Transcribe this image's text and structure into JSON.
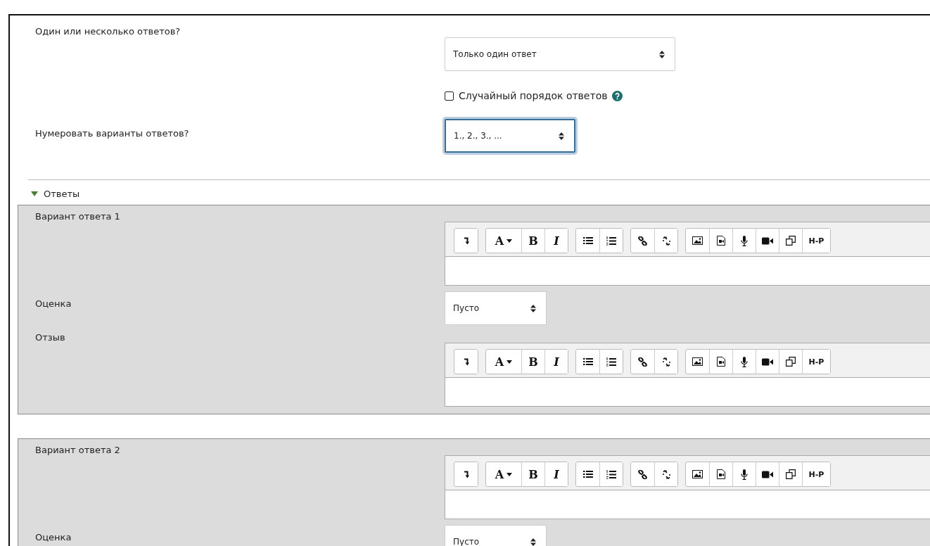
{
  "general_rows": [
    {
      "kind": "select",
      "label": "Один или несколько ответов?",
      "value": "Только один ответ",
      "focused": false
    },
    {
      "kind": "checkbox",
      "label": "Случайный порядок ответов",
      "checked": false,
      "help": true
    },
    {
      "kind": "select",
      "label": "Нумеровать варианты ответов?",
      "value": "1., 2., 3., ...",
      "focused": true
    }
  ],
  "section": {
    "title": "Ответы",
    "expanded": true
  },
  "answers": [
    {
      "fields": [
        {
          "kind": "editor",
          "label": "Вариант ответа 1",
          "toolbar": {
            "font_label": "A",
            "bold_label": "B",
            "italic_label": "I",
            "h5p_label": "H-P"
          }
        },
        {
          "kind": "select",
          "label": "Оценка",
          "value": "Пусто",
          "focused": false
        },
        {
          "kind": "editor",
          "label": "Отзыв",
          "toolbar": {
            "font_label": "A",
            "bold_label": "B",
            "italic_label": "I",
            "h5p_label": "H-P"
          }
        }
      ]
    },
    {
      "fields": [
        {
          "kind": "editor",
          "label": "Вариант ответа 2",
          "toolbar": {
            "font_label": "A",
            "bold_label": "B",
            "italic_label": "I",
            "h5p_label": "H-P"
          }
        },
        {
          "kind": "select",
          "label": "Оценка",
          "value": "Пусто",
          "focused": false
        }
      ]
    }
  ]
}
